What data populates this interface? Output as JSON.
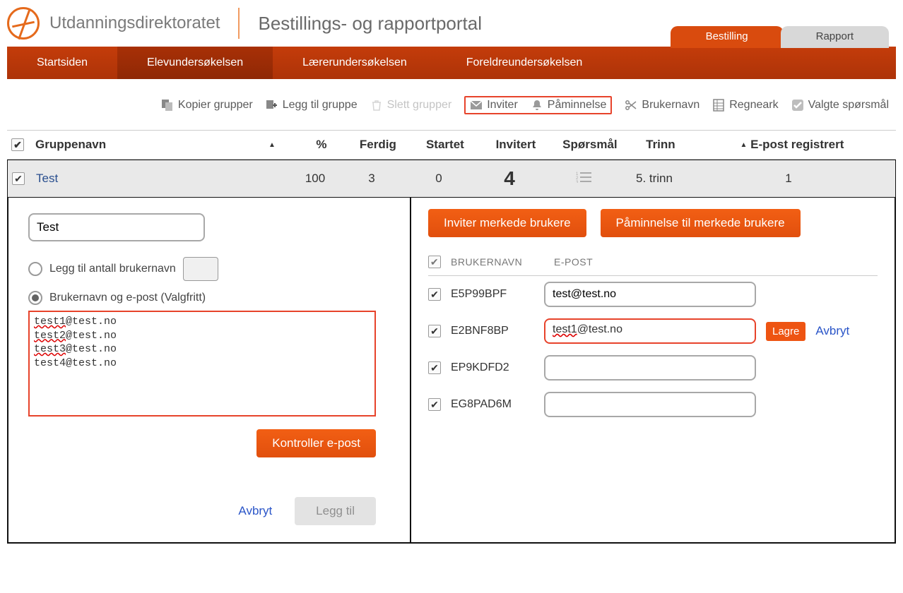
{
  "header": {
    "site_name": "Utdanningsdirektoratet",
    "portal_title": "Bestillings- og rapportportal",
    "tabs": {
      "bestilling": "Bestilling",
      "rapport": "Rapport"
    }
  },
  "nav": {
    "startsiden": "Startsiden",
    "elev": "Elevundersøkelsen",
    "laerer": "Lærerundersøkelsen",
    "foreldre": "Foreldreundersøkelsen"
  },
  "toolbar": {
    "kopier": "Kopier grupper",
    "legg_til": "Legg til gruppe",
    "slett": "Slett grupper",
    "inviter": "Inviter",
    "paminnelse": "Påminnelse",
    "brukernavn": "Brukernavn",
    "regneark": "Regneark",
    "valgte": "Valgte spørsmål"
  },
  "table": {
    "headers": {
      "gruppenavn": "Gruppenavn",
      "pct": "%",
      "ferdig": "Ferdig",
      "startet": "Startet",
      "invitert": "Invitert",
      "sporsmal": "Spørsmål",
      "trinn": "Trinn",
      "epost": "E-post registrert"
    },
    "row": {
      "name": "Test",
      "pct": "100",
      "ferdig": "3",
      "startet": "0",
      "invitert": "4",
      "trinn": "5. trinn",
      "epost": "1"
    }
  },
  "left": {
    "group_name_value": "Test",
    "radio_count_label": "Legg til antall brukernavn",
    "radio_email_label": "Brukernavn og e-post (Valgfritt)",
    "email_list_value": "test1@test.no\ntest2@test.no\ntest3@test.no\ntest4@test.no",
    "kontroller": "Kontroller e-post",
    "avbryt": "Avbryt",
    "legg_til": "Legg til"
  },
  "right": {
    "invite_btn": "Inviter merkede brukere",
    "remind_btn": "Påminnelse til merkede brukere",
    "col_user": "BRUKERNAVN",
    "col_email": "E-POST",
    "users": [
      {
        "name": "E5P99BPF",
        "email": "test@test.no"
      },
      {
        "name": "E2BNF8BP",
        "email": "test1@test.no"
      },
      {
        "name": "EP9KDFD2",
        "email": ""
      },
      {
        "name": "EG8PAD6M",
        "email": ""
      }
    ],
    "lagre": "Lagre",
    "avbryt": "Avbryt"
  }
}
